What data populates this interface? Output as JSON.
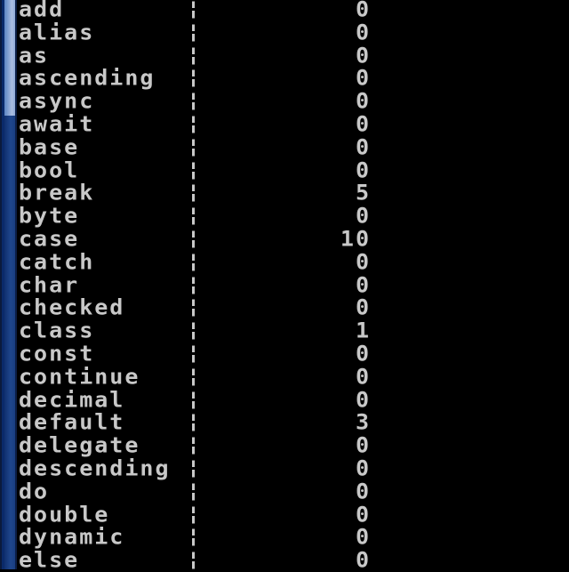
{
  "console": {
    "foreground": "#c8c8c8",
    "background": "#000000",
    "rows": [
      {
        "keyword": "add",
        "separator": "¦",
        "count": "0"
      },
      {
        "keyword": "alias",
        "separator": "¦",
        "count": "0"
      },
      {
        "keyword": "as",
        "separator": "¦",
        "count": "0"
      },
      {
        "keyword": "ascending",
        "separator": "¦",
        "count": "0"
      },
      {
        "keyword": "async",
        "separator": "¦",
        "count": "0"
      },
      {
        "keyword": "await",
        "separator": "¦",
        "count": "0"
      },
      {
        "keyword": "base",
        "separator": "¦",
        "count": "0"
      },
      {
        "keyword": "bool",
        "separator": "¦",
        "count": "0"
      },
      {
        "keyword": "break",
        "separator": "¦",
        "count": "5"
      },
      {
        "keyword": "byte",
        "separator": "¦",
        "count": "0"
      },
      {
        "keyword": "case",
        "separator": "¦",
        "count": "10"
      },
      {
        "keyword": "catch",
        "separator": "¦",
        "count": "0"
      },
      {
        "keyword": "char",
        "separator": "¦",
        "count": "0"
      },
      {
        "keyword": "checked",
        "separator": "¦",
        "count": "0"
      },
      {
        "keyword": "class",
        "separator": "¦",
        "count": "1"
      },
      {
        "keyword": "const",
        "separator": "¦",
        "count": "0"
      },
      {
        "keyword": "continue",
        "separator": "¦",
        "count": "0"
      },
      {
        "keyword": "decimal",
        "separator": "¦",
        "count": "0"
      },
      {
        "keyword": "default",
        "separator": "¦",
        "count": "3"
      },
      {
        "keyword": "delegate",
        "separator": "¦",
        "count": "0"
      },
      {
        "keyword": "descending",
        "separator": "¦",
        "count": "0"
      },
      {
        "keyword": "do",
        "separator": "¦",
        "count": "0"
      },
      {
        "keyword": "double",
        "separator": "¦",
        "count": "0"
      },
      {
        "keyword": "dynamic",
        "separator": "¦",
        "count": "0"
      },
      {
        "keyword": "else",
        "separator": "¦",
        "count": "0"
      }
    ]
  }
}
